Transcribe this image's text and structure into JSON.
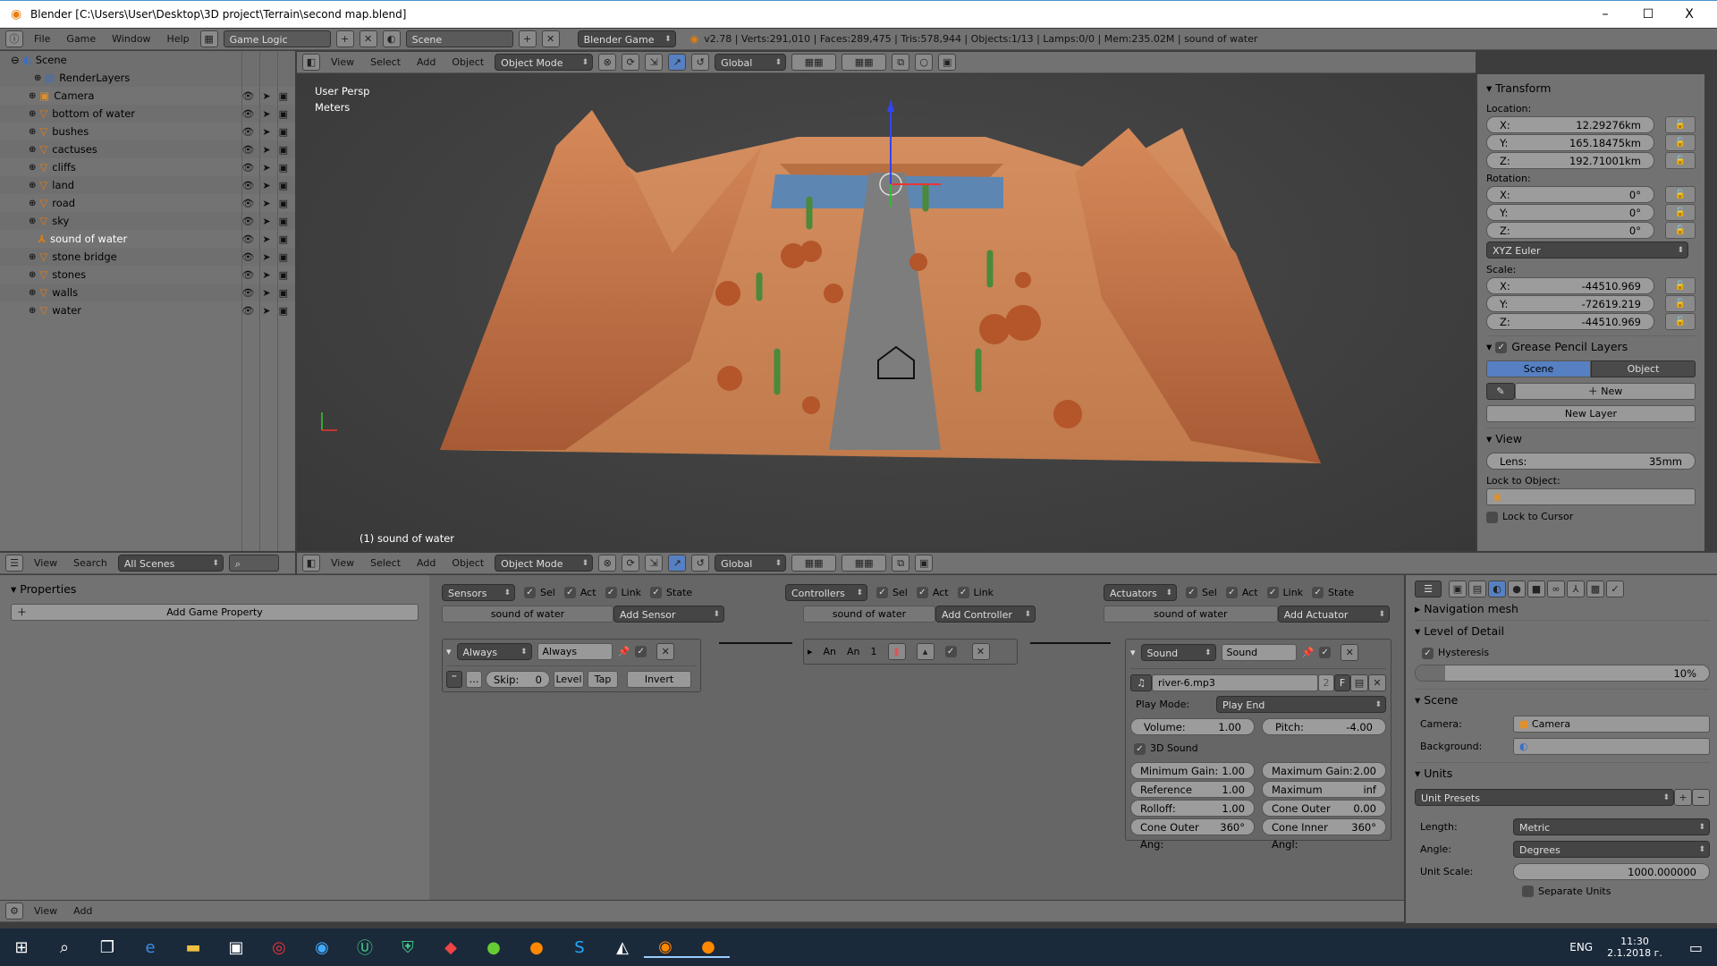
{
  "window": {
    "title": "Blender [C:\\Users\\User\\Desktop\\3D project\\Terrain\\second map.blend]",
    "minimize": "–",
    "maximize": "☐",
    "close": "X"
  },
  "info_header": {
    "menus": [
      "File",
      "Game",
      "Window",
      "Help"
    ],
    "screen_layout": "Game Logic",
    "scene": "Scene",
    "engine": "Blender Game",
    "stats": "v2.78 | Verts:291,010 | Faces:289,475 | Tris:578,944 | Objects:1/13 | Lamps:0/0 | Mem:235.02M | sound of water"
  },
  "outliner": {
    "root": "Scene",
    "items": [
      {
        "name": "RenderLayers",
        "icon": "renderlayers-icon"
      },
      {
        "name": "Camera",
        "icon": "camera-icon"
      },
      {
        "name": "bottom of water",
        "icon": "mesh-icon"
      },
      {
        "name": "bushes",
        "icon": "mesh-icon"
      },
      {
        "name": "cactuses",
        "icon": "mesh-icon"
      },
      {
        "name": "cliffs",
        "icon": "mesh-icon"
      },
      {
        "name": "land",
        "icon": "mesh-icon"
      },
      {
        "name": "road",
        "icon": "mesh-icon"
      },
      {
        "name": "sky",
        "icon": "mesh-icon"
      },
      {
        "name": "sound of water",
        "icon": "empty-icon",
        "selected": true
      },
      {
        "name": "stone bridge",
        "icon": "mesh-icon"
      },
      {
        "name": "stones",
        "icon": "mesh-icon"
      },
      {
        "name": "walls",
        "icon": "mesh-icon"
      },
      {
        "name": "water",
        "icon": "mesh-icon"
      }
    ],
    "footer": {
      "menus": [
        "View",
        "Search"
      ],
      "filter": "All Scenes"
    }
  },
  "viewport": {
    "menus": [
      "View",
      "Select",
      "Add",
      "Object"
    ],
    "mode": "Object Mode",
    "orientation": "Global",
    "view_name": "User Persp",
    "units": "Meters",
    "object_label": "(1) sound of water"
  },
  "npanel": {
    "transform": {
      "title": "Transform",
      "location_label": "Location:",
      "location": [
        {
          "axis": "X:",
          "value": "12.29276km"
        },
        {
          "axis": "Y:",
          "value": "165.18475km"
        },
        {
          "axis": "Z:",
          "value": "192.71001km"
        }
      ],
      "rotation_label": "Rotation:",
      "rotation": [
        {
          "axis": "X:",
          "value": "0°"
        },
        {
          "axis": "Y:",
          "value": "0°"
        },
        {
          "axis": "Z:",
          "value": "0°"
        }
      ],
      "rotation_mode": "XYZ Euler",
      "scale_label": "Scale:",
      "scale": [
        {
          "axis": "X:",
          "value": "-44510.969"
        },
        {
          "axis": "Y:",
          "value": "-72619.219"
        },
        {
          "axis": "Z:",
          "value": "-44510.969"
        }
      ]
    },
    "grease": {
      "title": "Grease Pencil Layers",
      "tab_scene": "Scene",
      "tab_object": "Object",
      "new": "New",
      "new_layer": "New Layer"
    },
    "view": {
      "title": "View",
      "lens_label": "Lens:",
      "lens": "35mm",
      "lock_object_label": "Lock to Object:",
      "lock_cursor": "Lock to Cursor"
    }
  },
  "properties": {
    "title": "Properties",
    "add_button": "Add Game Property"
  },
  "logic": {
    "sensors": {
      "label": "Sensors",
      "checks": [
        "Sel",
        "Act",
        "Link",
        "State"
      ],
      "object": "sound of water",
      "add": "Add Sensor",
      "brick": {
        "type": "Always",
        "name": "Always",
        "skip_label": "Skip:",
        "skip": "0",
        "level": "Level",
        "tap": "Tap",
        "invert": "Invert"
      }
    },
    "controllers": {
      "label": "Controllers",
      "checks": [
        "Sel",
        "Act",
        "Link"
      ],
      "object": "sound of water",
      "add": "Add Controller",
      "brick": {
        "t1": "An",
        "t2": "An",
        "num": "1"
      }
    },
    "actuators": {
      "label": "Actuators",
      "checks": [
        "Sel",
        "Act",
        "Link",
        "State"
      ],
      "object": "sound of water",
      "add": "Add Actuator",
      "brick": {
        "type": "Sound",
        "name": "Sound",
        "file": "river-6.mp3",
        "users": "2",
        "fake": "F",
        "play_mode_label": "Play Mode:",
        "play_mode": "Play End",
        "volume": {
          "label": "Volume:",
          "value": "1.00"
        },
        "pitch": {
          "label": "Pitch:",
          "value": "-4.00"
        },
        "sound3d": "3D Sound",
        "params": [
          {
            "label": "Minimum Gain:",
            "value": "1.00"
          },
          {
            "label": "Maximum Gain:",
            "value": "2.00"
          },
          {
            "label": "Reference Dista:",
            "value": "1.00"
          },
          {
            "label": "Maximum Distanc:",
            "value": "inf"
          },
          {
            "label": "Rolloff:",
            "value": "1.00"
          },
          {
            "label": "Cone Outer Gai:",
            "value": "0.00"
          },
          {
            "label": "Cone Outer Ang:",
            "value": "360°"
          },
          {
            "label": "Cone Inner Angl:",
            "value": "360°"
          }
        ]
      }
    },
    "footer_menus": [
      "View",
      "Add"
    ]
  },
  "scene_props": {
    "nav_mesh": "Navigation mesh",
    "lod": "Level of Detail",
    "hysteresis": "Hysteresis",
    "hysteresis_value": "10%",
    "hysteresis_fraction": 0.1,
    "scene": "Scene",
    "camera_label": "Camera:",
    "camera": "Camera",
    "background_label": "Background:",
    "units": "Units",
    "unit_presets": "Unit Presets",
    "length_label": "Length:",
    "length": "Metric",
    "angle_label": "Angle:",
    "angle": "Degrees",
    "scale_label": "Unit Scale:",
    "scale": "1000.000000",
    "separate": "Separate Units"
  },
  "taskbar": {
    "lang": "ENG",
    "time": "11:30",
    "date": "2.1.2018 г."
  }
}
